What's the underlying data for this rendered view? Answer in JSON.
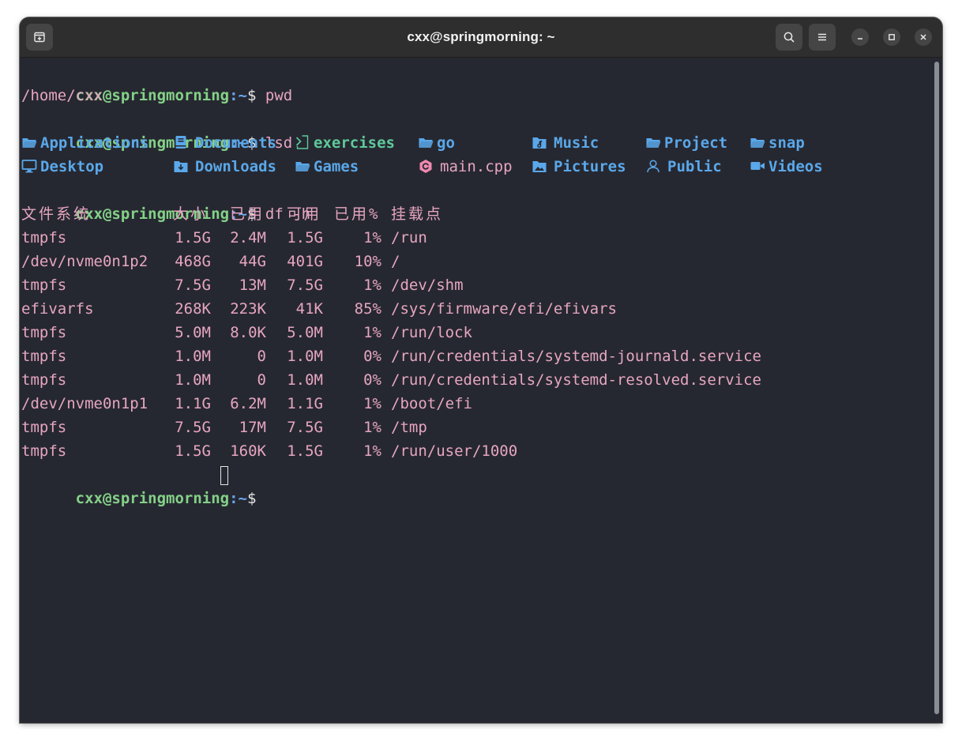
{
  "window": {
    "title": "cxx@springmorning: ~"
  },
  "prompt": {
    "user_host": "cxx@springmorning",
    "path_prefix": ":~",
    "dollar": "$ "
  },
  "commands": {
    "pwd": "pwd",
    "lsd": "lsd",
    "df": "df -h"
  },
  "pwd_output": "/home/cxx",
  "lsd_items": [
    {
      "name": "Applications",
      "icon": "folder-open-icon",
      "kind": "dir"
    },
    {
      "name": "Documents",
      "icon": "book-icon",
      "kind": "dir"
    },
    {
      "name": "exercises",
      "icon": "script-icon",
      "kind": "exe"
    },
    {
      "name": "go",
      "icon": "folder-open-icon",
      "kind": "dir"
    },
    {
      "name": "Music",
      "icon": "music-folder-icon",
      "kind": "dir"
    },
    {
      "name": "Project",
      "icon": "folder-open-icon",
      "kind": "dir"
    },
    {
      "name": "snap",
      "icon": "folder-open-icon",
      "kind": "dir"
    },
    {
      "name": "Desktop",
      "icon": "monitor-icon",
      "kind": "dir"
    },
    {
      "name": "Downloads",
      "icon": "download-folder-icon",
      "kind": "dir"
    },
    {
      "name": "Games",
      "icon": "folder-open-icon",
      "kind": "dir"
    },
    {
      "name": "main.cpp",
      "icon": "cpp-icon",
      "kind": "file"
    },
    {
      "name": "Pictures",
      "icon": "picture-folder-icon",
      "kind": "dir"
    },
    {
      "name": "Public",
      "icon": "person-icon",
      "kind": "dir"
    },
    {
      "name": "Videos",
      "icon": "video-icon",
      "kind": "dir"
    }
  ],
  "df": {
    "headers": [
      "文件系统",
      "大小",
      "已用",
      "可用",
      "已用%",
      "挂载点"
    ],
    "rows": [
      [
        "tmpfs",
        "1.5G",
        "2.4M",
        "1.5G",
        "1%",
        "/run"
      ],
      [
        "/dev/nvme0n1p2",
        "468G",
        "44G",
        "401G",
        "10%",
        "/"
      ],
      [
        "tmpfs",
        "7.5G",
        "13M",
        "7.5G",
        "1%",
        "/dev/shm"
      ],
      [
        "efivarfs",
        "268K",
        "223K",
        "41K",
        "85%",
        "/sys/firmware/efi/efivars"
      ],
      [
        "tmpfs",
        "5.0M",
        "8.0K",
        "5.0M",
        "1%",
        "/run/lock"
      ],
      [
        "tmpfs",
        "1.0M",
        "0",
        "1.0M",
        "0%",
        "/run/credentials/systemd-journald.service"
      ],
      [
        "tmpfs",
        "1.0M",
        "0",
        "1.0M",
        "0%",
        "/run/credentials/systemd-resolved.service"
      ],
      [
        "/dev/nvme0n1p1",
        "1.1G",
        "6.2M",
        "1.1G",
        "1%",
        "/boot/efi"
      ],
      [
        "tmpfs",
        "7.5G",
        "17M",
        "7.5G",
        "1%",
        "/tmp"
      ],
      [
        "tmpfs",
        "1.5G",
        "160K",
        "1.5G",
        "1%",
        "/run/user/1000"
      ]
    ]
  },
  "colors": {
    "background": "#262831",
    "prompt_user": "#84d187",
    "prompt_path": "#6aa6ee",
    "text": "#e6a6c0",
    "directory": "#5aa8ea",
    "executable": "#5ec99a"
  }
}
